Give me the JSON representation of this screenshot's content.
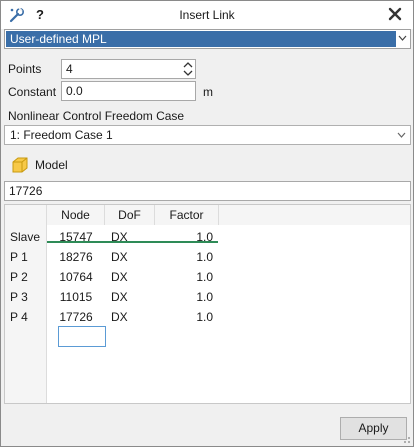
{
  "window": {
    "title": "Insert Link",
    "help_label": "?"
  },
  "mpl_combo": {
    "value": "User-defined MPL"
  },
  "points": {
    "label": "Points",
    "value": "4"
  },
  "constant": {
    "label": "Constant",
    "value": "0.0",
    "unit": "m"
  },
  "freedom_case": {
    "label": "Nonlinear Control Freedom Case",
    "value": "1: Freedom Case 1"
  },
  "model": {
    "label": "Model",
    "value": "17726"
  },
  "table": {
    "columns": [
      "Node",
      "DoF",
      "Factor"
    ],
    "rows": [
      {
        "label": "Slave",
        "node": "15747",
        "dof": "DX",
        "factor": "1.0"
      },
      {
        "label": "P 1",
        "node": "18276",
        "dof": "DX",
        "factor": "1.0"
      },
      {
        "label": "P 2",
        "node": "10764",
        "dof": "DX",
        "factor": "1.0"
      },
      {
        "label": "P 3",
        "node": "11015",
        "dof": "DX",
        "factor": "1.0"
      },
      {
        "label": "P 4",
        "node": "17726",
        "dof": "DX",
        "factor": "1.0"
      }
    ]
  },
  "footer": {
    "apply_label": "Apply"
  },
  "colors": {
    "selection": "#3a6ea8",
    "accent_line": "#2e8b57",
    "focus": "#5b9bd5"
  }
}
